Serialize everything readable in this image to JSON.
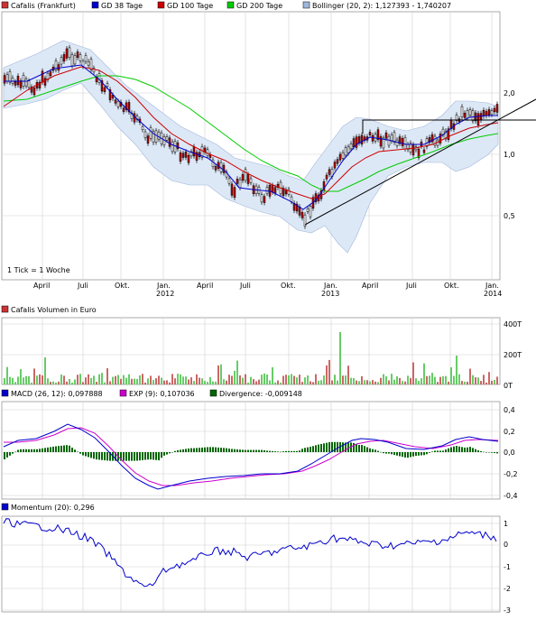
{
  "colors": {
    "bg": "#ffffff",
    "grid": "#c8c8c8",
    "price_up": "#ffffff",
    "price_down": "#c00000",
    "gd38": "#0000cc",
    "gd100": "#cc0000",
    "gd200": "#00cc00",
    "bollinger_fill": "#dde8f6",
    "bollinger_line": "#8aa6d6",
    "trend": "#000000",
    "vol_up": "#66cc66",
    "vol_down": "#cc6666",
    "macd": "#0000cc",
    "exp": "#cc00cc",
    "divergence": "#006600",
    "momentum": "#0000cc"
  },
  "price_panel": {
    "legend": [
      {
        "label": "Cafalis (Frankfurt)",
        "color": "#cc3333"
      },
      {
        "label": "GD 38 Tage",
        "color": "#0000cc"
      },
      {
        "label": "GD 100 Tage",
        "color": "#cc0000"
      },
      {
        "label": "GD 200 Tage",
        "color": "#00cc00"
      },
      {
        "label": "Bollinger (20, 2): 1,127393 - 1,740207",
        "color": "#a0b8dc"
      }
    ],
    "note": "1 Tick = 1 Woche",
    "y_ticks": [
      "2,0",
      "1,0",
      "0,5"
    ]
  },
  "volume_panel": {
    "legend": "Cafalis Volumen in Euro",
    "y_ticks": [
      "400T",
      "200T",
      "0T"
    ]
  },
  "macd_panel": {
    "legend": [
      {
        "label": "MACD (26, 12): 0,097888",
        "color": "#0000cc"
      },
      {
        "label": "EXP (9): 0,107036",
        "color": "#cc00cc"
      },
      {
        "label": "Divergence: -0,009148",
        "color": "#006600"
      }
    ],
    "y_ticks": [
      "0,4",
      "0,2",
      "0,0",
      "-0,2",
      "-0,4"
    ]
  },
  "momentum_panel": {
    "legend": "Momentum (20): 0,296",
    "y_ticks": [
      "1",
      "0",
      "-1",
      "-2",
      "-3"
    ]
  },
  "x_axis": {
    "months": [
      "April",
      "Juli",
      "Okt.",
      "Jan.",
      "April",
      "Juli",
      "Okt.",
      "Jan.",
      "April",
      "Juli",
      "Okt.",
      "Jan."
    ],
    "years": [
      "2012",
      "2013",
      "2014"
    ]
  },
  "chart_data": {
    "type": "line",
    "title": "Cafalis (Frankfurt)",
    "x": [
      "2011-04",
      "2011-07",
      "2011-10",
      "2012-01",
      "2012-04",
      "2012-07",
      "2012-10",
      "2013-01",
      "2013-04",
      "2013-07",
      "2013-10",
      "2014-01"
    ],
    "series": [
      {
        "name": "Cafalis (Frankfurt)",
        "values": [
          2.1,
          2.3,
          1.8,
          1.25,
          1.15,
          0.8,
          0.65,
          0.9,
          1.3,
          1.2,
          1.55,
          1.7
        ]
      },
      {
        "name": "GD 38 Tage",
        "values": [
          2.0,
          2.2,
          1.95,
          1.4,
          1.15,
          0.85,
          0.7,
          0.8,
          1.15,
          1.2,
          1.4,
          1.6
        ]
      },
      {
        "name": "GD 100 Tage",
        "values": [
          1.7,
          2.1,
          2.05,
          1.6,
          1.25,
          1.0,
          0.78,
          0.75,
          1.0,
          1.15,
          1.3,
          1.45
        ]
      },
      {
        "name": "GD 200 Tage",
        "values": [
          1.7,
          1.9,
          1.95,
          1.75,
          1.45,
          1.15,
          0.95,
          0.82,
          0.92,
          1.05,
          1.2,
          1.35
        ]
      }
    ],
    "ylim": [
      0.35,
      3.0
    ],
    "yscale": "log",
    "volume": {
      "name": "Cafalis Volumen in Euro",
      "ylim": [
        0,
        400000
      ]
    },
    "macd": [
      {
        "name": "MACD (26, 12)",
        "last": 0.097888
      },
      {
        "name": "EXP (9)",
        "last": 0.107036
      },
      {
        "name": "Divergence",
        "last": -0.009148
      }
    ],
    "momentum": {
      "name": "Momentum (20)",
      "last": 0.296
    }
  }
}
